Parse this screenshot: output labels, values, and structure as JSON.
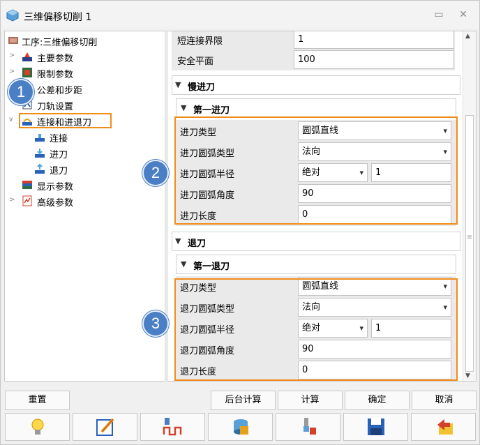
{
  "window": {
    "title": "三维偏移切削 1"
  },
  "tree": {
    "root_label": "工序:三维偏移切削",
    "items": [
      {
        "label": "主要参数",
        "icon": "main-params-icon"
      },
      {
        "label": "限制参数",
        "icon": "limit-params-icon"
      },
      {
        "label": "公差和步距",
        "icon": "tolerance-icon"
      },
      {
        "label": "刀轨设置",
        "icon": "toolpath-icon"
      },
      {
        "label": "连接和进退刀",
        "icon": "link-icon",
        "selected": true
      },
      {
        "label": "连接",
        "icon": "link-sub-icon"
      },
      {
        "label": "进刀",
        "icon": "lead-in-icon"
      },
      {
        "label": "退刀",
        "icon": "lead-out-icon"
      },
      {
        "label": "显示参数",
        "icon": "display-icon"
      },
      {
        "label": "高级参数",
        "icon": "advanced-icon"
      }
    ]
  },
  "props": {
    "top_rows": [
      {
        "label": "短连接界限",
        "value": "1"
      },
      {
        "label": "安全平面",
        "value": "100"
      }
    ],
    "lead_in_section": "慢进刀",
    "first_lead_in": "第一进刀",
    "lead_in_rows": [
      {
        "label": "进刀类型",
        "value": "圆弧直线"
      },
      {
        "label": "进刀圆弧类型",
        "value": "法向"
      },
      {
        "label": "进刀圆弧半径",
        "value": "绝对",
        "value2": "1"
      },
      {
        "label": "进刀圆弧角度",
        "value": "90"
      },
      {
        "label": "进刀长度",
        "value": "0"
      }
    ],
    "lead_out_section": "退刀",
    "first_lead_out": "第一退刀",
    "lead_out_rows": [
      {
        "label": "退刀类型",
        "value": "圆弧直线"
      },
      {
        "label": "退刀圆弧类型",
        "value": "法向"
      },
      {
        "label": "退刀圆弧半径",
        "value": "绝对",
        "value2": "1"
      },
      {
        "label": "退刀圆弧角度",
        "value": "90"
      },
      {
        "label": "退刀长度",
        "value": "0"
      }
    ]
  },
  "badges": [
    "1",
    "2",
    "3"
  ],
  "buttons": {
    "reset": "重置",
    "background_calc": "后台计算",
    "calc": "计算",
    "ok": "确定",
    "cancel": "取消"
  },
  "toolbar_icons": [
    "bulb-icon",
    "edit-icon",
    "tool-path-icon",
    "db-icon",
    "tool-icon",
    "save-icon",
    "exit-icon"
  ],
  "colors": {
    "accent": "#f08c1a",
    "badge": "#4a7fc5"
  }
}
